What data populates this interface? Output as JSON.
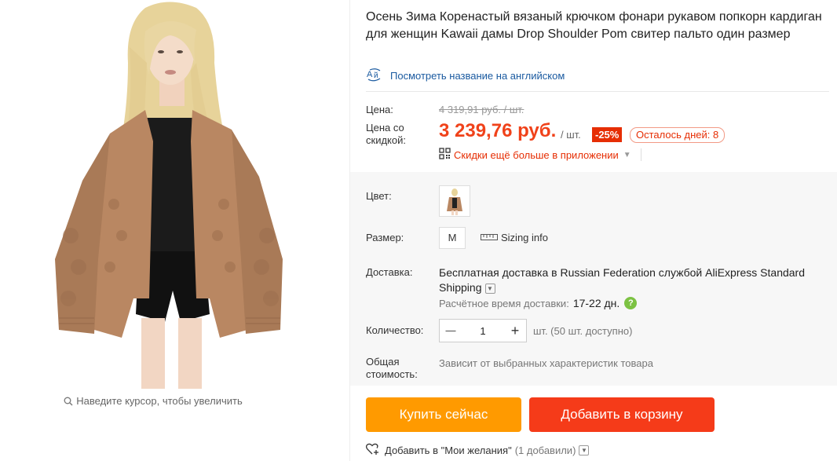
{
  "gallery": {
    "zoom_hint": "Наведите курсор, чтобы увеличить"
  },
  "product": {
    "title": "Осень Зима Коренастый вязаный крючком фонари рукавом попкорн кардиган для женщин Kawaii дамы Drop Shoulder Pom свитер пальто один размер",
    "translate_link": "Посмотреть название на английском"
  },
  "pricing": {
    "price_label": "Цена:",
    "original_price": "4 319,91 руб. / шт.",
    "discount_label_line1": "Цена со",
    "discount_label_line2": "скидкой:",
    "price": "3 239,76 руб.",
    "unit": "/ шт.",
    "discount_badge": "-25%",
    "days_left": "Осталось дней: 8",
    "app_promo": "Скидки ещё больше в приложении"
  },
  "options": {
    "color_label": "Цвет:",
    "size_label": "Размер:",
    "size_value": "M",
    "sizing_info": "Sizing info"
  },
  "shipping": {
    "label": "Доставка:",
    "free_text": "Бесплатная доставка в",
    "country": "Russian Federation",
    "via": "службой",
    "service": "AliExpress Standard Shipping",
    "eta_label": "Расчётное время доставки:",
    "eta_value": "17-22 дн."
  },
  "quantity": {
    "label": "Количество:",
    "value": "1",
    "minus": "—",
    "plus": "+",
    "stock": "шт. (50 шт. доступно)"
  },
  "total": {
    "label_line1": "Общая",
    "label_line2": "стоимость:",
    "value": "Зависит от выбранных характеристик товара"
  },
  "actions": {
    "buy_now": "Купить сейчас",
    "add_to_cart": "Добавить в корзину",
    "wishlist": "Добавить в \"Мои желания\"",
    "wishlist_count": "(1 добавили)"
  },
  "colors": {
    "price_red": "#f0421a",
    "buy_orange": "#ff9a00",
    "cart_red": "#f53b19",
    "link_blue": "#1a5aa0",
    "cardigan": "#b98762"
  }
}
